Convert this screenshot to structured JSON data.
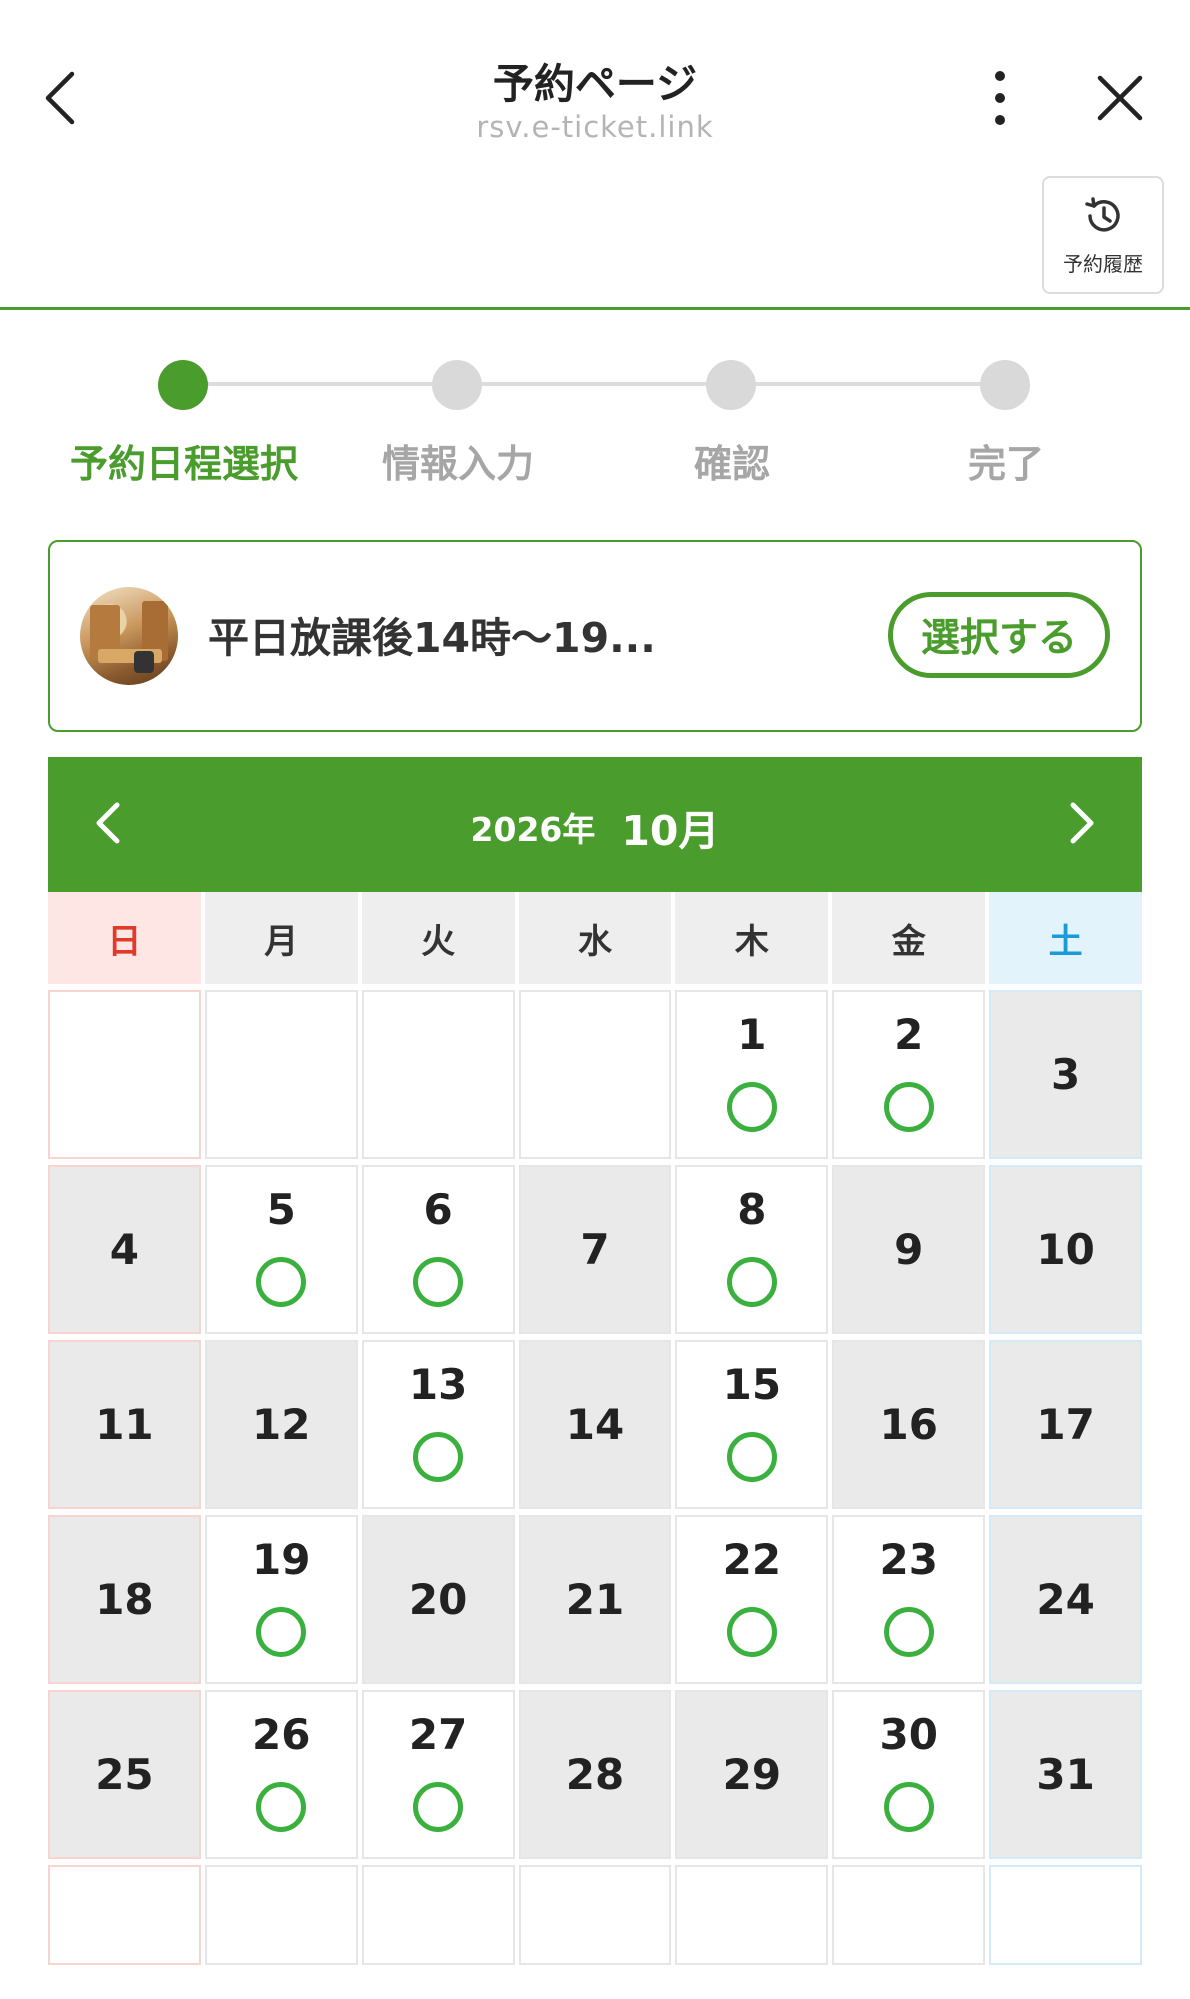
{
  "header": {
    "title": "予約ページ",
    "url": "rsv.e-ticket.link",
    "history_label": "予約履歴"
  },
  "steps": [
    {
      "label": "予約日程選択",
      "active": true
    },
    {
      "label": "情報入力",
      "active": false
    },
    {
      "label": "確認",
      "active": false
    },
    {
      "label": "完了",
      "active": false
    }
  ],
  "plan": {
    "name": "平日放課後14時〜19...",
    "select_label": "選択する"
  },
  "calendar": {
    "year_label": "2026年",
    "month_label": "10月",
    "weekdays": [
      "日",
      "月",
      "火",
      "水",
      "木",
      "金",
      "土"
    ],
    "available_symbol": "◯",
    "weeks": [
      [
        null,
        null,
        null,
        null,
        {
          "day": "1",
          "available": true
        },
        {
          "day": "2",
          "available": true
        },
        {
          "day": "3",
          "available": false
        }
      ],
      [
        {
          "day": "4",
          "available": false
        },
        {
          "day": "5",
          "available": true
        },
        {
          "day": "6",
          "available": true
        },
        {
          "day": "7",
          "available": false
        },
        {
          "day": "8",
          "available": true
        },
        {
          "day": "9",
          "available": false
        },
        {
          "day": "10",
          "available": false
        }
      ],
      [
        {
          "day": "11",
          "available": false
        },
        {
          "day": "12",
          "available": false
        },
        {
          "day": "13",
          "available": true
        },
        {
          "day": "14",
          "available": false
        },
        {
          "day": "15",
          "available": true
        },
        {
          "day": "16",
          "available": false
        },
        {
          "day": "17",
          "available": false
        }
      ],
      [
        {
          "day": "18",
          "available": false
        },
        {
          "day": "19",
          "available": true
        },
        {
          "day": "20",
          "available": false
        },
        {
          "day": "21",
          "available": false
        },
        {
          "day": "22",
          "available": true
        },
        {
          "day": "23",
          "available": true
        },
        {
          "day": "24",
          "available": false
        }
      ],
      [
        {
          "day": "25",
          "available": false
        },
        {
          "day": "26",
          "available": true
        },
        {
          "day": "27",
          "available": true
        },
        {
          "day": "28",
          "available": false
        },
        {
          "day": "29",
          "available": false
        },
        {
          "day": "30",
          "available": true
        },
        {
          "day": "31",
          "available": false
        }
      ],
      [
        null,
        null,
        null,
        null,
        null,
        null,
        null
      ]
    ]
  },
  "colors": {
    "accent": "#4a9c2d",
    "available": "#3ab03e",
    "sunday": "#e03a2a",
    "saturday": "#1a9ad6"
  }
}
